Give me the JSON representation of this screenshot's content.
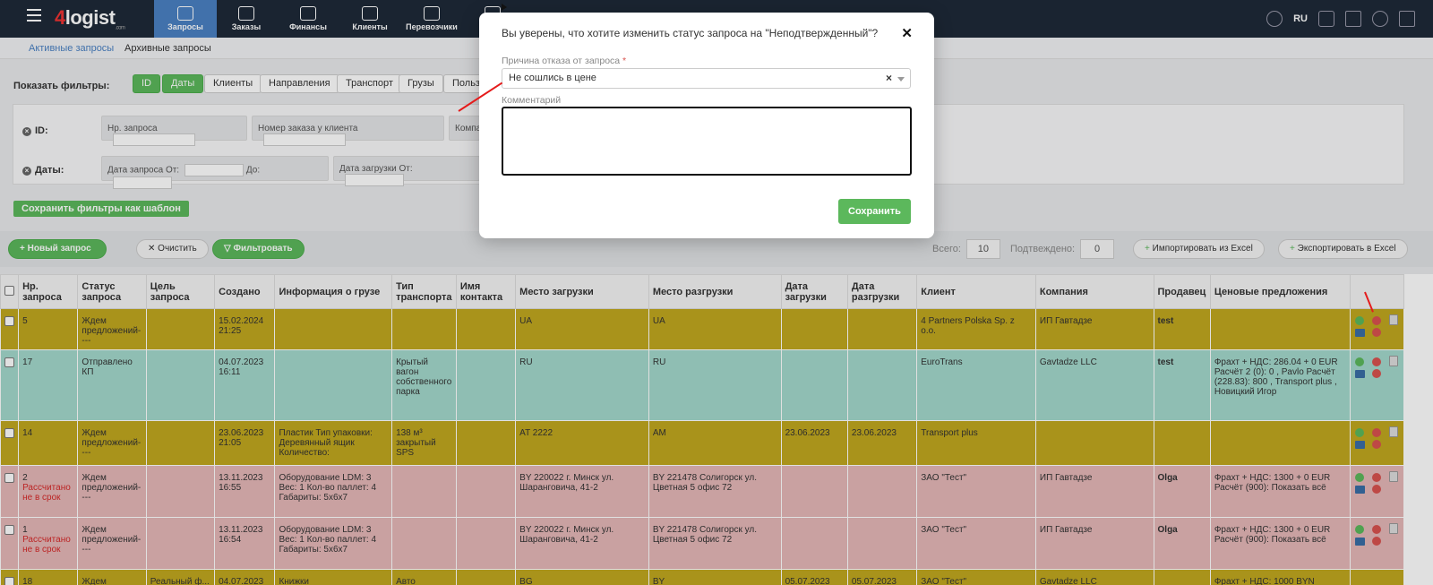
{
  "app": {
    "logo_four": "4",
    "logo_name": "logist",
    "logo_suffix": ".com"
  },
  "nav": {
    "items": [
      {
        "label": "Запросы",
        "icon": "chat-bubble-icon"
      },
      {
        "label": "Заказы",
        "icon": "package-icon"
      },
      {
        "label": "Финансы",
        "icon": "money-bag-icon"
      },
      {
        "label": "Клиенты",
        "icon": "users-icon"
      },
      {
        "label": "Перевозчики",
        "icon": "truck-icon"
      },
      {
        "label": "",
        "icon": "calculator-icon"
      },
      {
        "label": "",
        "icon": "document-icon"
      },
      {
        "label": "",
        "icon": "calendar-icon"
      },
      {
        "label": "",
        "icon": "gear-icon"
      }
    ],
    "lang": "RU"
  },
  "subnav": {
    "active": "Активные запросы",
    "archive": "Архивные запросы"
  },
  "filters": {
    "label": "Показать фильтры:",
    "buttons": [
      "ID",
      "Даты",
      "Клиенты",
      "Направления",
      "Транспорт",
      "Грузы",
      "Польз"
    ],
    "row_id_label": "ID:",
    "row_dates_label": "Даты:",
    "id_fields": [
      "Нр. запроса",
      "Номер заказа у клиента",
      "Компа"
    ],
    "date_fields": [
      "Дата запроса От:",
      "До:",
      "Дата загрузки От:"
    ],
    "save_template": "Сохранить фильтры как шаблон"
  },
  "toolbar": {
    "new_request": "Новый запрос",
    "clear": "Очистить",
    "filter": "Фильтровать",
    "total_label": "Всего:",
    "total_value": "10",
    "confirmed_label": "Подтвеждено:",
    "confirmed_value": "0",
    "import_excel": "Импортировать из Excel",
    "export_excel": "Экспортировать в Excel"
  },
  "table": {
    "headers": [
      "Нр. запроса",
      "Статус запроса",
      "Цель запроса",
      "Создано",
      "Информация о грузе",
      "Тип транспорта",
      "Имя контакта",
      "Место загрузки",
      "Место разгрузки",
      "Дата загрузки",
      "Дата разгрузки",
      "Клиент",
      "Компания",
      "Продавец",
      "Ценовые предложения"
    ],
    "rows": [
      {
        "color": "yellow",
        "num": "5",
        "status": "Ждем предложений----",
        "note": "",
        "purpose": "",
        "created": "15.02.2024 21:25",
        "cargo": "",
        "transport": "",
        "contact": "",
        "load": "UA",
        "unload": "UA",
        "load_date": "",
        "unload_date": "",
        "client": "4 Partners Polska Sp. z o.o.",
        "company": "ИП Гавтадзе",
        "seller": "test",
        "offers": ""
      },
      {
        "color": "teal",
        "num": "17",
        "status": "Отправлено КП",
        "note": "",
        "purpose": "",
        "created": "04.07.2023 16:11",
        "cargo": "",
        "transport": "Крытый вагон собственного парка",
        "contact": "",
        "load": "RU",
        "unload": "RU",
        "load_date": "",
        "unload_date": "",
        "client": "EuroTrans",
        "company": "Gavtadze LLC",
        "seller": "test",
        "offers": "Фрахт + НДС: 286.04 + 0 EUR Расчёт 2 (0): 0 , Pavlo Расчёт (228.83): 800 , Transport plus , Новицкий Игор"
      },
      {
        "color": "yellow",
        "num": "14",
        "status": "Ждем предложений----",
        "note": "",
        "purpose": "",
        "created": "23.06.2023 21:05",
        "cargo": "Пластик Тип упаковки: Деревянный ящик Количество:",
        "transport": "138 м³ закрытый SPS",
        "contact": "",
        "load": "AT 2222",
        "unload": "AM",
        "load_date": "23.06.2023",
        "unload_date": "23.06.2023",
        "client": "Transport plus",
        "company": "",
        "seller": "",
        "offers": ""
      },
      {
        "color": "pink",
        "num": "2",
        "status": "Ждем предложений----",
        "note": "Рассчитано не в срок",
        "purpose": "",
        "created": "13.11.2023 16:55",
        "cargo": "Оборудование LDM: 3 Вес: 1 Кол-во паллет: 4 Габариты: 5х6х7",
        "transport": "",
        "contact": "",
        "load": "BY 220022 г. Минск ул. Шаранговича, 41-2",
        "unload": "BY 221478 Солигорск ул. Цветная 5 офис 72",
        "load_date": "",
        "unload_date": "",
        "client": "ЗАО \"Тест\"",
        "company": "ИП Гавтадзе",
        "seller": "Olga",
        "offers": "Фрахт + НДС: 1300 + 0 EUR Расчёт (900): Показать всё"
      },
      {
        "color": "pink",
        "num": "1",
        "status": "Ждем предложений----",
        "note": "Рассчитано не в срок",
        "purpose": "",
        "created": "13.11.2023 16:54",
        "cargo": "Оборудование LDM: 3 Вес: 1 Кол-во паллет: 4 Габариты: 5х6х7",
        "transport": "",
        "contact": "",
        "load": "BY 220022 г. Минск ул. Шаранговича, 41-2",
        "unload": "BY 221478 Солигорск ул. Цветная 5 офис 72",
        "load_date": "",
        "unload_date": "",
        "client": "ЗАО \"Тест\"",
        "company": "ИП Гавтадзе",
        "seller": "Olga",
        "offers": "Фрахт + НДС: 1300 + 0 EUR Расчёт (900): Показать всё"
      },
      {
        "color": "yellow",
        "num": "18",
        "status": "Ждем",
        "note": "",
        "purpose": "Реальный ф...",
        "created": "04.07.2023",
        "cargo": "Книжки",
        "transport": "Авто",
        "contact": "",
        "load": "BG",
        "unload": "BY",
        "load_date": "05.07.2023",
        "unload_date": "05.07.2023",
        "client": "ЗАО \"Тест\"",
        "company": "Gavtadze LLC",
        "seller": "",
        "offers": "Фрахт + НДС: 1000 BYN"
      }
    ]
  },
  "modal": {
    "title": "Вы уверены, что хотите изменить статус запроса на \"Неподтвержденный\"?",
    "reason_label": "Причина отказа от запроса",
    "required_mark": "*",
    "reason_value": "Не сошлись в цене",
    "clear_symbol": "×",
    "comment_label": "Комментарий",
    "comment_value": "",
    "save": "Сохранить",
    "close_symbol": "✕"
  },
  "colors": {
    "topbar": "#1e2a38",
    "active_tab": "#4a81c3",
    "green": "#5cb85c",
    "row_yellow": "#c1a81f",
    "row_teal": "#a3d9cc",
    "row_pink": "#e5b8b8",
    "annotation_arrow": "#e51b1b"
  }
}
